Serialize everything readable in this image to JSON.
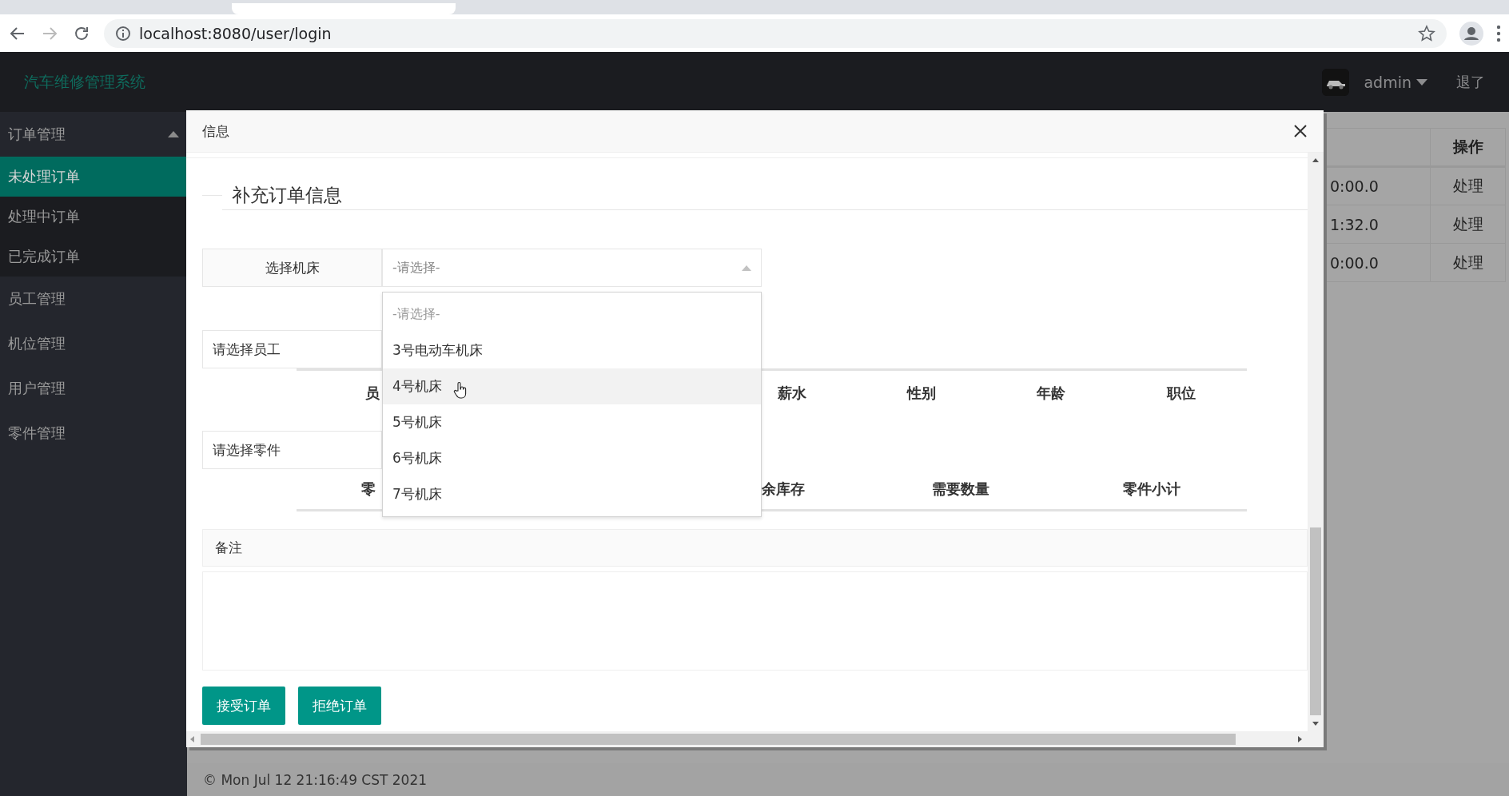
{
  "browser": {
    "url": "localhost:8080/user/login"
  },
  "header": {
    "title": "汽车维修管理系统",
    "user": "admin",
    "logout": "退了"
  },
  "sidebar": {
    "items": [
      {
        "label": "订单管理",
        "selected": false,
        "expanded": true,
        "children": [
          {
            "label": "未处理订单",
            "selected": true
          },
          {
            "label": "处理中订单",
            "selected": false
          },
          {
            "label": "已完成订单",
            "selected": false
          }
        ]
      },
      {
        "label": "员工管理",
        "selected": false
      },
      {
        "label": "机位管理",
        "selected": false
      },
      {
        "label": "用户管理",
        "selected": false
      },
      {
        "label": "零件管理",
        "selected": false
      }
    ]
  },
  "background_table": {
    "columns": [
      "操作"
    ],
    "rows": [
      {
        "column_1": "0:00.0",
        "action": "处理"
      },
      {
        "column_1": "1:32.0",
        "action": "处理"
      },
      {
        "column_1": "0:00.0",
        "action": "处理"
      }
    ]
  },
  "dialog": {
    "title": "信息",
    "section_title": "补充订单信息",
    "machine_select": {
      "label": "选择机床",
      "placeholder": "-请选择-",
      "open": true,
      "options": [
        {
          "label": "-请选择-",
          "kind": "placeholder",
          "hovered": false
        },
        {
          "label": "3号电动车机床",
          "kind": "option",
          "hovered": false
        },
        {
          "label": "4号机床",
          "kind": "option",
          "hovered": true
        },
        {
          "label": "5号机床",
          "kind": "option",
          "hovered": false
        },
        {
          "label": "6号机床",
          "kind": "option",
          "hovered": false
        },
        {
          "label": "7号机床",
          "kind": "option",
          "hovered": false
        }
      ]
    },
    "employee": {
      "label": "请选择员工",
      "columns": [
        {
          "label": "员"
        },
        {
          "label": "薪水"
        },
        {
          "label": "性别"
        },
        {
          "label": "年龄"
        },
        {
          "label": "职位"
        }
      ]
    },
    "parts": {
      "label": "请选择零件",
      "columns": [
        {
          "label": "零"
        },
        {
          "label": "余库存"
        },
        {
          "label": "需要数量"
        },
        {
          "label": "零件小计"
        }
      ]
    },
    "remarks": {
      "label": "备注"
    },
    "buttons": [
      {
        "label": "接受订单"
      },
      {
        "label": "拒绝订单"
      }
    ]
  },
  "footer": {
    "text": "© Mon Jul 12 21:16:49 CST 2021"
  }
}
